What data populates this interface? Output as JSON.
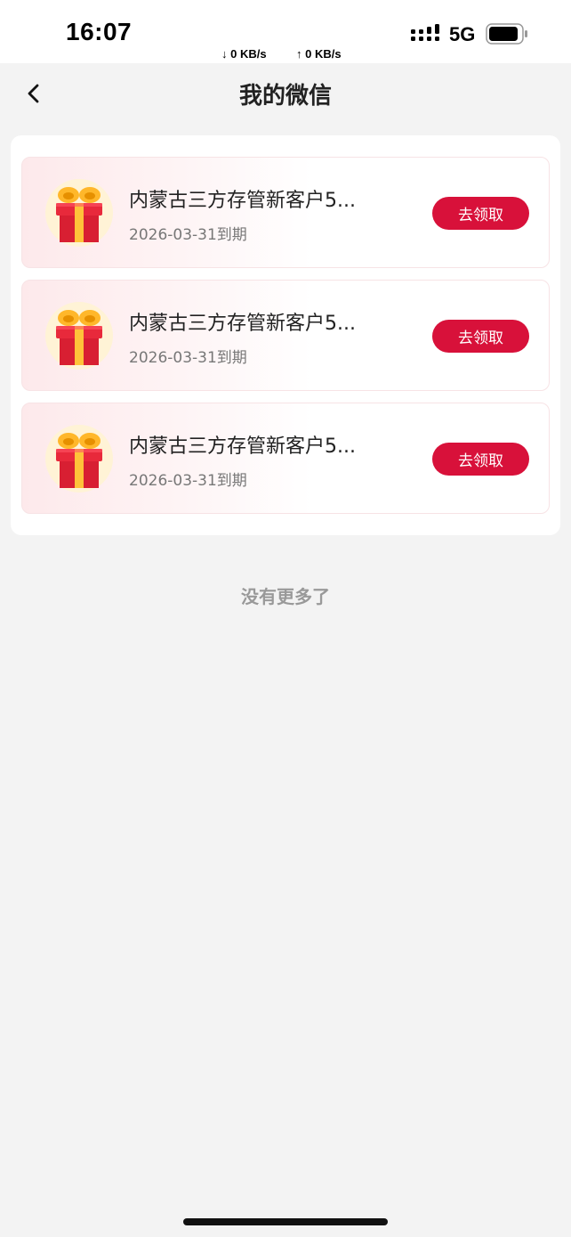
{
  "status_bar": {
    "time": "16:07",
    "download_speed": "↓ 0 KB/s",
    "upload_speed": "↑ 0 KB/s",
    "network": "5G",
    "signal_icon": "signal-bars-icon",
    "battery_icon": "battery-icon"
  },
  "nav": {
    "back_icon": "chevron-left-icon",
    "title": "我的微信"
  },
  "coupons": [
    {
      "title": "内蒙古三方存管新客户5...",
      "expiry": "2026-03-31到期",
      "button": "去领取",
      "icon": "gift-box-icon"
    },
    {
      "title": "内蒙古三方存管新客户5...",
      "expiry": "2026-03-31到期",
      "button": "去领取",
      "icon": "gift-box-icon"
    },
    {
      "title": "内蒙古三方存管新客户5...",
      "expiry": "2026-03-31到期",
      "button": "去领取",
      "icon": "gift-box-icon"
    }
  ],
  "footer_text": "没有更多了",
  "colors": {
    "accent": "#d8113a",
    "background": "#f3f3f3",
    "card": "#ffffff"
  }
}
